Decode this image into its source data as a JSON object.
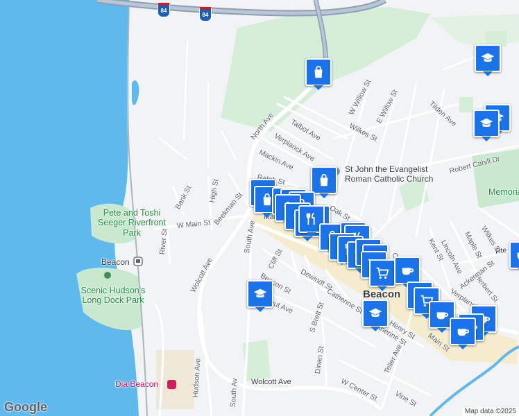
{
  "colors": {
    "water": "#5fb9ec",
    "park": "#c9e9cf",
    "road": "#ffffff",
    "highway": "#8d9fb5",
    "pin": "#1a73e8",
    "downtown": "#f5eccd"
  },
  "places": {
    "riverfront_park": "Pete and Toshi Seeger Riverfront Park",
    "dock_park": "Scenic Hudson's Long Dock Park",
    "station": "Beacon",
    "church": "St John the Evangelist Roman Catholic Church",
    "dia": "Dia Beacon",
    "town": "Beacon",
    "memorial": "Memoria"
  },
  "streets": {
    "north_ave": "North Ave",
    "talbot": "Talbot Ave",
    "verplanck": "Verplanck Ave",
    "mackin": "Mackin Ave",
    "w_willow": "W Willow St",
    "e_willow": "E Willow St",
    "wilkes": "Wilkes St",
    "tilden": "Tilden Ave",
    "robert_cahill": "Robert Cahill Dr",
    "ralph": "Ralph St",
    "beekman": "Beekman St",
    "high": "High St",
    "bank": "Bank St",
    "w_main": "W Main St",
    "river": "River St",
    "wolcott_w": "Wolcott Ave",
    "south_ave": "South Ave",
    "main": "Main St",
    "cliff": "Cliff St",
    "beacon_st": "Beacon St",
    "dewindt": "Dewindt St",
    "catherine": "Catherine St",
    "catherine2": "Catherine St",
    "s_brett": "S Brett St",
    "henry": "Henry St",
    "teller": "Teller Ave",
    "prout": "Prout Ave",
    "dinan": "Dinan St",
    "w_center": "W Center St",
    "vine": "Vine St",
    "wolcott_s": "Wolcott Ave",
    "hudson": "Hudson Ave",
    "south2": "South Av",
    "oak": "Oak St",
    "oak2": "Oak",
    "kent": "Kent St",
    "lincoln": "Lincoln Ave",
    "maple": "Maple St",
    "wilkes2": "Wilkes St",
    "herbert": "Herbert St",
    "ackerman": "Ackerman St",
    "verplanck2": "Verplanck",
    "main2": "Main St",
    "rte": "Rte"
  },
  "shields": [
    "84",
    "84"
  ],
  "footer": {
    "logo": "Google",
    "attribution": "Map data ©2025"
  }
}
